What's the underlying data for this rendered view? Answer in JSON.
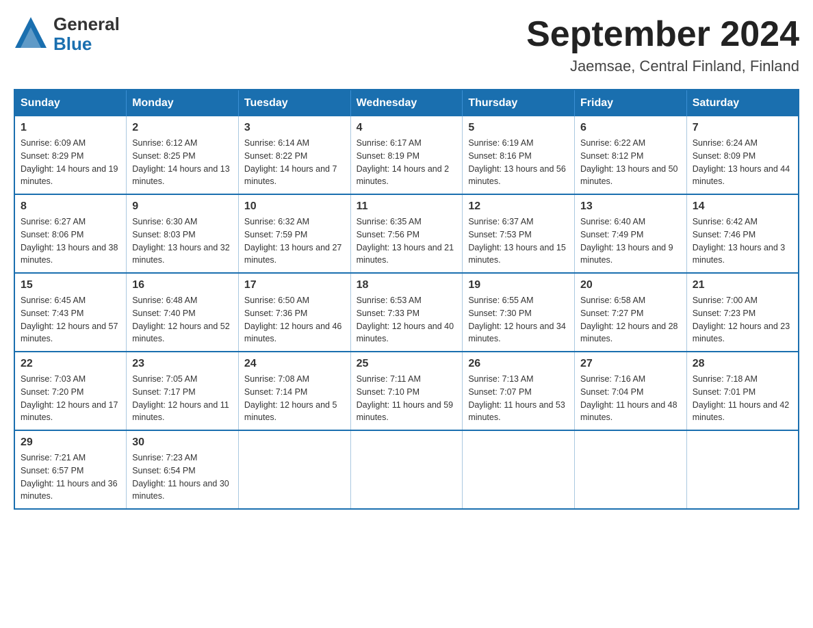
{
  "logo": {
    "general": "General",
    "blue": "Blue",
    "arrow_color": "#1a6faf"
  },
  "title": {
    "month_year": "September 2024",
    "location": "Jaemsae, Central Finland, Finland"
  },
  "weekdays": [
    "Sunday",
    "Monday",
    "Tuesday",
    "Wednesday",
    "Thursday",
    "Friday",
    "Saturday"
  ],
  "weeks": [
    [
      {
        "day": "1",
        "sunrise": "Sunrise: 6:09 AM",
        "sunset": "Sunset: 8:29 PM",
        "daylight": "Daylight: 14 hours and 19 minutes."
      },
      {
        "day": "2",
        "sunrise": "Sunrise: 6:12 AM",
        "sunset": "Sunset: 8:25 PM",
        "daylight": "Daylight: 14 hours and 13 minutes."
      },
      {
        "day": "3",
        "sunrise": "Sunrise: 6:14 AM",
        "sunset": "Sunset: 8:22 PM",
        "daylight": "Daylight: 14 hours and 7 minutes."
      },
      {
        "day": "4",
        "sunrise": "Sunrise: 6:17 AM",
        "sunset": "Sunset: 8:19 PM",
        "daylight": "Daylight: 14 hours and 2 minutes."
      },
      {
        "day": "5",
        "sunrise": "Sunrise: 6:19 AM",
        "sunset": "Sunset: 8:16 PM",
        "daylight": "Daylight: 13 hours and 56 minutes."
      },
      {
        "day": "6",
        "sunrise": "Sunrise: 6:22 AM",
        "sunset": "Sunset: 8:12 PM",
        "daylight": "Daylight: 13 hours and 50 minutes."
      },
      {
        "day": "7",
        "sunrise": "Sunrise: 6:24 AM",
        "sunset": "Sunset: 8:09 PM",
        "daylight": "Daylight: 13 hours and 44 minutes."
      }
    ],
    [
      {
        "day": "8",
        "sunrise": "Sunrise: 6:27 AM",
        "sunset": "Sunset: 8:06 PM",
        "daylight": "Daylight: 13 hours and 38 minutes."
      },
      {
        "day": "9",
        "sunrise": "Sunrise: 6:30 AM",
        "sunset": "Sunset: 8:03 PM",
        "daylight": "Daylight: 13 hours and 32 minutes."
      },
      {
        "day": "10",
        "sunrise": "Sunrise: 6:32 AM",
        "sunset": "Sunset: 7:59 PM",
        "daylight": "Daylight: 13 hours and 27 minutes."
      },
      {
        "day": "11",
        "sunrise": "Sunrise: 6:35 AM",
        "sunset": "Sunset: 7:56 PM",
        "daylight": "Daylight: 13 hours and 21 minutes."
      },
      {
        "day": "12",
        "sunrise": "Sunrise: 6:37 AM",
        "sunset": "Sunset: 7:53 PM",
        "daylight": "Daylight: 13 hours and 15 minutes."
      },
      {
        "day": "13",
        "sunrise": "Sunrise: 6:40 AM",
        "sunset": "Sunset: 7:49 PM",
        "daylight": "Daylight: 13 hours and 9 minutes."
      },
      {
        "day": "14",
        "sunrise": "Sunrise: 6:42 AM",
        "sunset": "Sunset: 7:46 PM",
        "daylight": "Daylight: 13 hours and 3 minutes."
      }
    ],
    [
      {
        "day": "15",
        "sunrise": "Sunrise: 6:45 AM",
        "sunset": "Sunset: 7:43 PM",
        "daylight": "Daylight: 12 hours and 57 minutes."
      },
      {
        "day": "16",
        "sunrise": "Sunrise: 6:48 AM",
        "sunset": "Sunset: 7:40 PM",
        "daylight": "Daylight: 12 hours and 52 minutes."
      },
      {
        "day": "17",
        "sunrise": "Sunrise: 6:50 AM",
        "sunset": "Sunset: 7:36 PM",
        "daylight": "Daylight: 12 hours and 46 minutes."
      },
      {
        "day": "18",
        "sunrise": "Sunrise: 6:53 AM",
        "sunset": "Sunset: 7:33 PM",
        "daylight": "Daylight: 12 hours and 40 minutes."
      },
      {
        "day": "19",
        "sunrise": "Sunrise: 6:55 AM",
        "sunset": "Sunset: 7:30 PM",
        "daylight": "Daylight: 12 hours and 34 minutes."
      },
      {
        "day": "20",
        "sunrise": "Sunrise: 6:58 AM",
        "sunset": "Sunset: 7:27 PM",
        "daylight": "Daylight: 12 hours and 28 minutes."
      },
      {
        "day": "21",
        "sunrise": "Sunrise: 7:00 AM",
        "sunset": "Sunset: 7:23 PM",
        "daylight": "Daylight: 12 hours and 23 minutes."
      }
    ],
    [
      {
        "day": "22",
        "sunrise": "Sunrise: 7:03 AM",
        "sunset": "Sunset: 7:20 PM",
        "daylight": "Daylight: 12 hours and 17 minutes."
      },
      {
        "day": "23",
        "sunrise": "Sunrise: 7:05 AM",
        "sunset": "Sunset: 7:17 PM",
        "daylight": "Daylight: 12 hours and 11 minutes."
      },
      {
        "day": "24",
        "sunrise": "Sunrise: 7:08 AM",
        "sunset": "Sunset: 7:14 PM",
        "daylight": "Daylight: 12 hours and 5 minutes."
      },
      {
        "day": "25",
        "sunrise": "Sunrise: 7:11 AM",
        "sunset": "Sunset: 7:10 PM",
        "daylight": "Daylight: 11 hours and 59 minutes."
      },
      {
        "day": "26",
        "sunrise": "Sunrise: 7:13 AM",
        "sunset": "Sunset: 7:07 PM",
        "daylight": "Daylight: 11 hours and 53 minutes."
      },
      {
        "day": "27",
        "sunrise": "Sunrise: 7:16 AM",
        "sunset": "Sunset: 7:04 PM",
        "daylight": "Daylight: 11 hours and 48 minutes."
      },
      {
        "day": "28",
        "sunrise": "Sunrise: 7:18 AM",
        "sunset": "Sunset: 7:01 PM",
        "daylight": "Daylight: 11 hours and 42 minutes."
      }
    ],
    [
      {
        "day": "29",
        "sunrise": "Sunrise: 7:21 AM",
        "sunset": "Sunset: 6:57 PM",
        "daylight": "Daylight: 11 hours and 36 minutes."
      },
      {
        "day": "30",
        "sunrise": "Sunrise: 7:23 AM",
        "sunset": "Sunset: 6:54 PM",
        "daylight": "Daylight: 11 hours and 30 minutes."
      },
      null,
      null,
      null,
      null,
      null
    ]
  ]
}
